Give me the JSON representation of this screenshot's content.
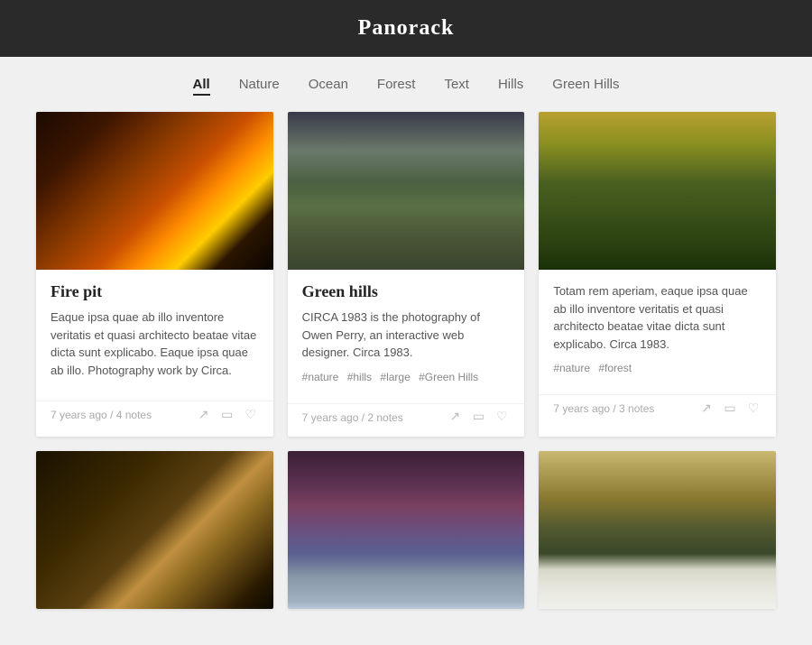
{
  "header": {
    "title": "Panorack"
  },
  "nav": {
    "items": [
      {
        "label": "All",
        "active": true
      },
      {
        "label": "Nature",
        "active": false
      },
      {
        "label": "Ocean",
        "active": false
      },
      {
        "label": "Forest",
        "active": false
      },
      {
        "label": "Text",
        "active": false
      },
      {
        "label": "Hills",
        "active": false
      },
      {
        "label": "Green Hills",
        "active": false
      }
    ]
  },
  "gallery": {
    "cards": [
      {
        "id": "firepit",
        "title": "Fire pit",
        "description": "Eaque ipsa quae ab illo inventore veritatis et quasi architecto beatae vitae dicta sunt explicabo. Eaque ipsa quae ab illo. Photography work by Circa.",
        "tags": [],
        "meta": "7 years ago / 4 notes",
        "image_type": "firepit"
      },
      {
        "id": "greenhills",
        "title": "Green hills",
        "description": "CIRCA 1983 is the photography of Owen Perry, an interactive web designer. Circa 1983.",
        "tags": [
          "#nature",
          "#hills",
          "#large",
          "#Green Hills"
        ],
        "meta": "7 years ago / 2 notes",
        "image_type": "greenhills"
      },
      {
        "id": "forest",
        "title": "",
        "description": "Totam rem aperiam, eaque ipsa quae ab illo inventore veritatis et quasi architecto beatae vitae dicta sunt explicabo. Circa 1983.",
        "tags": [
          "#nature",
          "#forest"
        ],
        "meta": "7 years ago / 3 notes",
        "image_type": "forest"
      },
      {
        "id": "cockpit",
        "title": "",
        "description": "",
        "tags": [],
        "meta": "",
        "image_type": "cockpit"
      },
      {
        "id": "ocean",
        "title": "",
        "description": "",
        "tags": [],
        "meta": "",
        "image_type": "ocean"
      },
      {
        "id": "clouds",
        "title": "",
        "description": "",
        "tags": [],
        "meta": "",
        "image_type": "clouds"
      }
    ]
  }
}
